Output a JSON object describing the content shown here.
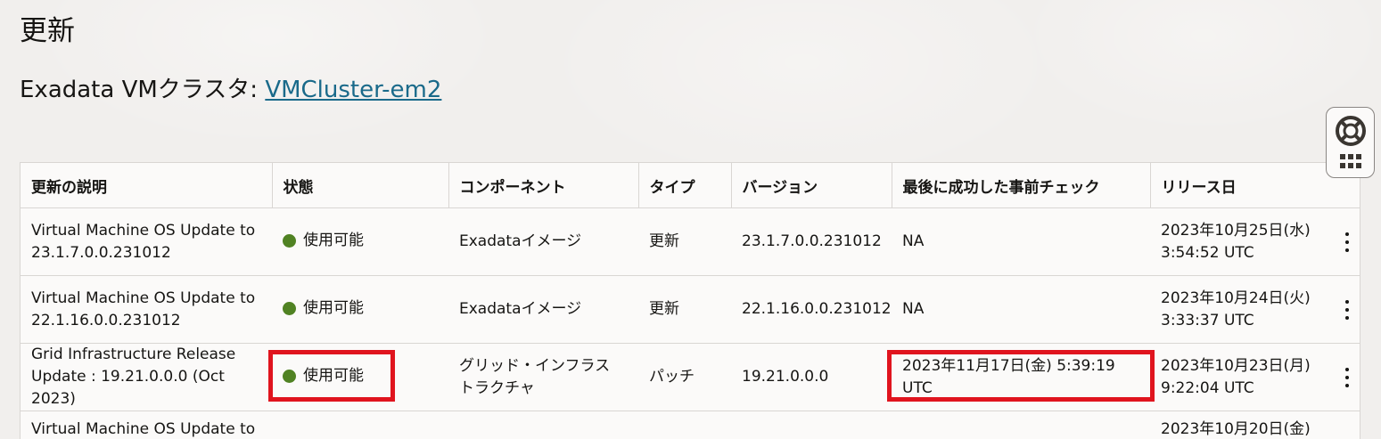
{
  "page": {
    "title": "更新",
    "subtitle_prefix": "Exadata VMクラスタ: ",
    "cluster_link": "VMCluster-em2"
  },
  "table": {
    "headers": [
      "更新の説明",
      "状態",
      "コンポーネント",
      "タイプ",
      "バージョン",
      "最後に成功した事前チェック",
      "リリース日"
    ],
    "rows": [
      {
        "description_line1": "Virtual Machine OS Update to",
        "description_line2": "23.1.7.0.0.231012",
        "status": "使用可能",
        "component_line1": "Exadataイメージ",
        "component_line2": "",
        "type": "更新",
        "version": "23.1.7.0.0.231012",
        "precheck": "NA",
        "release_line1": "2023年10月25日(水)",
        "release_line2": "3:54:52 UTC"
      },
      {
        "description_line1": "Virtual Machine OS Update to",
        "description_line2": "22.1.16.0.0.231012",
        "status": "使用可能",
        "component_line1": "Exadataイメージ",
        "component_line2": "",
        "type": "更新",
        "version": "22.1.16.0.0.231012",
        "precheck": "NA",
        "release_line1": "2023年10月24日(火)",
        "release_line2": "3:33:37 UTC"
      },
      {
        "description_line1": "Grid Infrastructure Release",
        "description_line2": "Update : 19.21.0.0.0 (Oct 2023)",
        "status": "使用可能",
        "component_line1": "グリッド・インフラス",
        "component_line2": "トラクチャ",
        "type": "パッチ",
        "version": "19.21.0.0.0",
        "precheck": "2023年11月17日(金) 5:39:19 UTC",
        "release_line1": "2023年10月23日(月)",
        "release_line2": "9:22:04 UTC"
      }
    ],
    "partial_row": {
      "description": "Virtual Machine OS Update to",
      "release": "2023年10月20日(金)"
    }
  },
  "colors": {
    "status_available": "#508223",
    "highlight": "#e0141e",
    "link": "#1a6a8a"
  },
  "icons": {
    "help": "lifebuoy-icon",
    "apps": "grid-menu-icon",
    "row_actions": "kebab-menu-icon"
  }
}
